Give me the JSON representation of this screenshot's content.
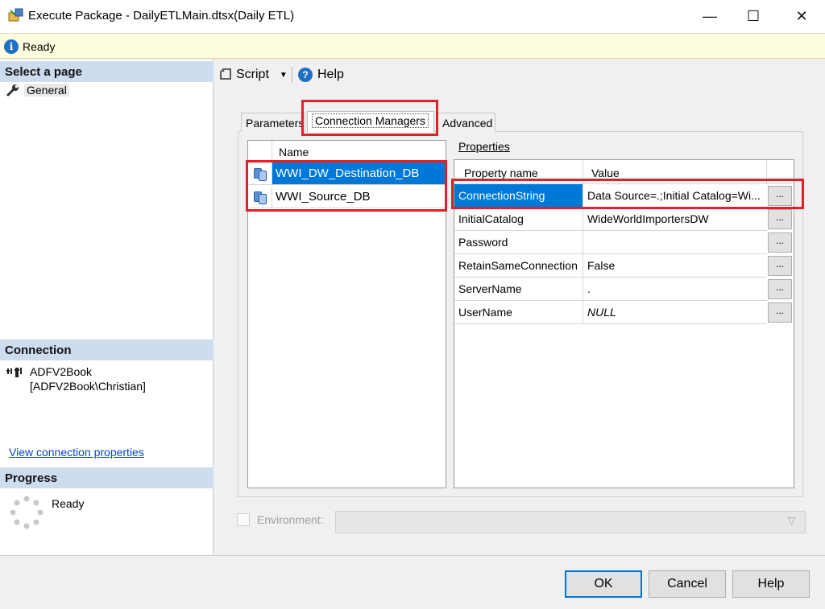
{
  "window": {
    "title": "Execute Package - DailyETLMain.dtsx(Daily ETL)",
    "minimize": "—",
    "maximize": "☐",
    "close": "✕"
  },
  "status": {
    "text": "Ready",
    "icon": "info-icon"
  },
  "left_pane": {
    "select_page_header": "Select a page",
    "pages": [
      {
        "label": "General",
        "icon": "wrench-icon"
      }
    ],
    "connection_header": "Connection",
    "connection_server": "ADFV2Book",
    "connection_user": "[ADFV2Book\\Christian]",
    "view_connection_link": "View connection properties",
    "progress_header": "Progress",
    "progress_status": "Ready"
  },
  "toolbar": {
    "script_label": "Script",
    "help_label": "Help"
  },
  "tabs": [
    {
      "label": "Parameters",
      "active": false
    },
    {
      "label": "Connection Managers",
      "active": true
    },
    {
      "label": "Advanced",
      "active": false
    }
  ],
  "connection_managers": {
    "column_header": "Name",
    "items": [
      {
        "name": "WWI_DW_Destination_DB",
        "selected": true
      },
      {
        "name": "WWI_Source_DB",
        "selected": false
      }
    ]
  },
  "properties": {
    "label": "Properties",
    "columns": [
      "Property name",
      "Value"
    ],
    "rows": [
      {
        "name": "ConnectionString",
        "value": "Data Source=.;Initial Catalog=Wi...",
        "selected": true
      },
      {
        "name": "InitialCatalog",
        "value": "WideWorldImportersDW"
      },
      {
        "name": "Password",
        "value": ""
      },
      {
        "name": "RetainSameConnection",
        "value": "False"
      },
      {
        "name": "ServerName",
        "value": "."
      },
      {
        "name": "UserName",
        "value": "NULL",
        "italic": true
      }
    ],
    "ellipsis_label": "..."
  },
  "environment": {
    "label": "Environment:",
    "checked": false,
    "value": ""
  },
  "buttons": {
    "ok": "OK",
    "cancel": "Cancel",
    "help": "Help"
  },
  "colors": {
    "selection": "#0078d7",
    "header": "#cddcef",
    "status_bg": "#fffde0",
    "highlight": "#e0202a"
  }
}
